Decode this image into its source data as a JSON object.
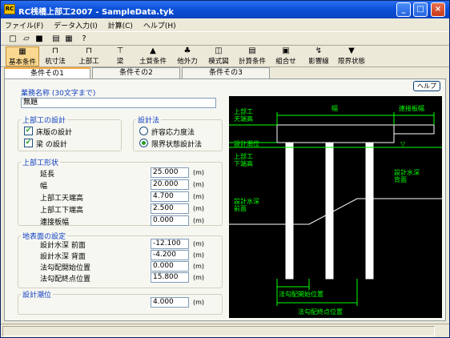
{
  "window": {
    "title": "RC桟橋上部工2007 - SampleData.tyk"
  },
  "menu": [
    "ファイル(F)",
    "データ入力(I)",
    "計算(C)",
    "ヘルプ(H)"
  ],
  "toolbar1": [
    {
      "icon": "new-icon",
      "glyph": "□"
    },
    {
      "icon": "open-icon",
      "glyph": "▱"
    },
    {
      "icon": "save-icon",
      "glyph": "■"
    },
    {
      "icon": "preview-icon",
      "glyph": "▤"
    },
    {
      "icon": "print-icon",
      "glyph": "▦"
    },
    {
      "icon": "help-icon",
      "glyph": "?"
    }
  ],
  "toolbar2": [
    {
      "label": "基本条件",
      "icon": "basic-conditions-icon",
      "glyph": "▦"
    },
    {
      "label": "杭寸法",
      "icon": "pile-dimensions-icon",
      "glyph": "⊓"
    },
    {
      "label": "上部工",
      "icon": "superstructure-icon",
      "glyph": "⊓"
    },
    {
      "label": "梁",
      "icon": "beam-icon",
      "glyph": "⊤"
    },
    {
      "label": "土質条件",
      "icon": "soil-conditions-icon",
      "glyph": "▲"
    },
    {
      "label": "他外力",
      "icon": "external-force-icon",
      "glyph": "♣"
    },
    {
      "label": "模式図",
      "icon": "schematic-icon",
      "glyph": "◫"
    },
    {
      "label": "計算条件",
      "icon": "calc-conditions-icon",
      "glyph": "▤"
    },
    {
      "label": "組合せ",
      "icon": "combination-icon",
      "glyph": "▣"
    },
    {
      "label": "影響線",
      "icon": "influence-line-icon",
      "glyph": "↯"
    },
    {
      "label": "限界状態",
      "icon": "limit-state-icon",
      "glyph": "▼"
    }
  ],
  "tabs": [
    "条件その1",
    "条件その2",
    "条件その3"
  ],
  "help_label": "ヘルプ",
  "project": {
    "label": "業務名称 (30文字まで)",
    "value": "無題"
  },
  "superstructure_design": {
    "title": "上部工の設計",
    "options": [
      {
        "label": "床版の設計",
        "checked": true
      },
      {
        "label": "梁 の設計",
        "checked": true
      }
    ]
  },
  "design_method": {
    "title": "設計法",
    "options": [
      {
        "label": "許容応力度法",
        "selected": false
      },
      {
        "label": "限界状態設計法",
        "selected": true
      }
    ]
  },
  "shape": {
    "title": "上部工形状",
    "rows": [
      {
        "label": "延長",
        "value": "25.000",
        "unit": "(m)"
      },
      {
        "label": "幅",
        "value": "20.000",
        "unit": "(m)"
      },
      {
        "label": "上部工天端高",
        "value": "4.700",
        "unit": "(m)"
      },
      {
        "label": "上部工下端高",
        "value": "2.500",
        "unit": "(m)"
      },
      {
        "label": "連接板幅",
        "value": "0.000",
        "unit": "(m)"
      }
    ]
  },
  "ground": {
    "title": "地表面の設定",
    "rows": [
      {
        "label": "設計水深  前面",
        "value": "-12.100",
        "unit": "(m)"
      },
      {
        "label": "設計水深  背面",
        "value": "-4.200",
        "unit": "(m)"
      },
      {
        "label": "法勾配開始位置",
        "value": "0.000",
        "unit": "(m)"
      },
      {
        "label": "法勾配終点位置",
        "value": "15.800",
        "unit": "(m)"
      }
    ]
  },
  "tide": {
    "title": "設計潮位",
    "value": "4.000",
    "unit": "(m)"
  },
  "diagram_labels": {
    "top_elev": "上部工\n天端高",
    "width": "幅",
    "joint_width": "連接板幅",
    "design_tide": "設計潮位",
    "bottom_elev": "上部工\n下端高",
    "depth_back": "設計水深\n背面",
    "depth_front": "設計水深\n前面",
    "slope_start": "法勾配開始位置",
    "slope_end": "法勾配終点位置",
    "tide_symbol": "▽"
  },
  "colors": {
    "diagram_bg": "#000000",
    "diagram_line": "#ffffff",
    "diagram_text": "#00ff00",
    "accent": "#1040c0"
  }
}
